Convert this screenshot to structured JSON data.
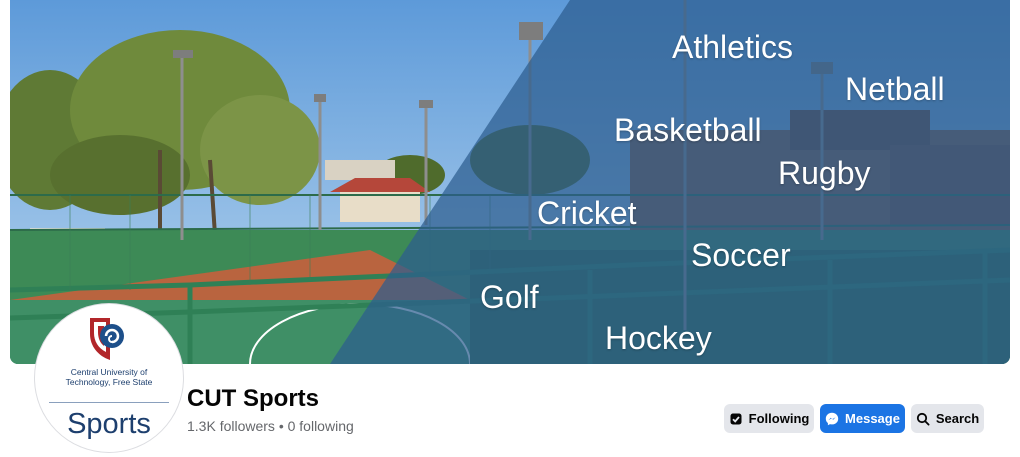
{
  "cover": {
    "sports": [
      "Athletics",
      "Netball",
      "Basketball",
      "Rugby",
      "Cricket",
      "Soccer",
      "Golf",
      "Hockey"
    ]
  },
  "avatar": {
    "university_line1": "Central University of",
    "university_line2": "Technology, Free State",
    "label": "Sports"
  },
  "page": {
    "name": "CUT Sports",
    "stats": "1.3K followers • 0 following"
  },
  "actions": {
    "following": "Following",
    "message": "Message",
    "search": "Search"
  },
  "colors": {
    "primary": "#1b74e4",
    "secondary": "#e4e6eb",
    "cover_overlay": "#2c5d8f"
  }
}
